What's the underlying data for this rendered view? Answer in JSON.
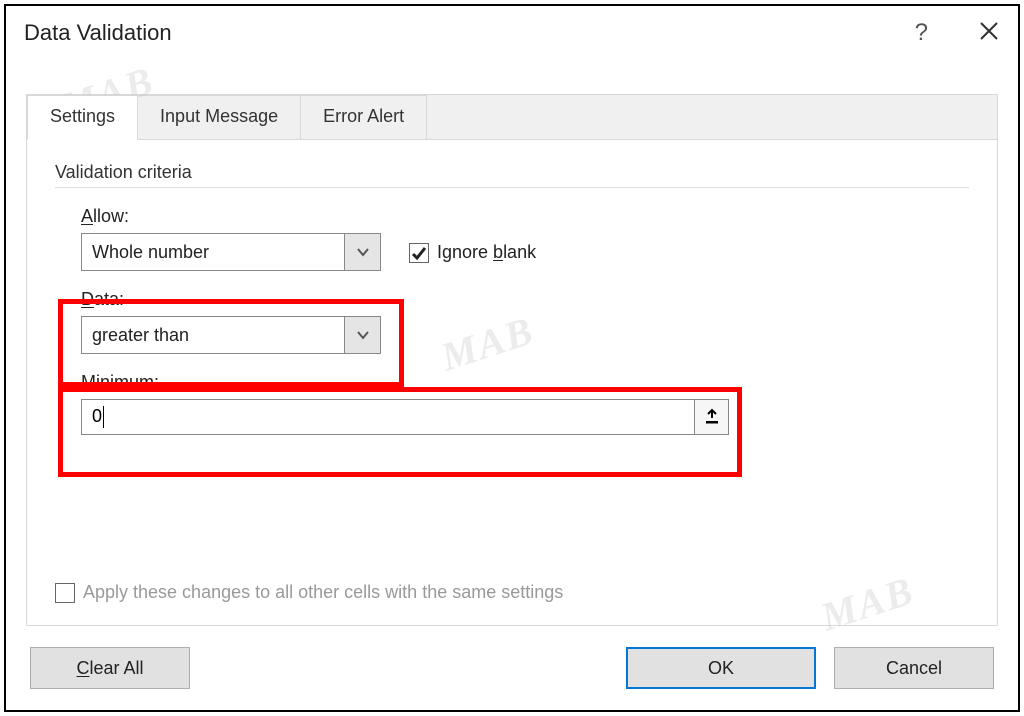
{
  "dialog": {
    "title": "Data Validation",
    "help": "?",
    "close": "✕"
  },
  "tabs": {
    "settings": "Settings",
    "input_message": "Input Message",
    "error_alert": "Error Alert"
  },
  "group_label": "Validation criteria",
  "allow": {
    "label_pre": "A",
    "label_rest": "llow:",
    "value": "Whole number"
  },
  "ignore_blank": {
    "pre": "Ignore ",
    "u": "b",
    "rest": "lank",
    "checked": true
  },
  "data": {
    "label_u": "D",
    "label_rest": "ata:",
    "value": "greater than"
  },
  "minimum": {
    "label_u": "M",
    "label_rest": "inimum:",
    "value": "0"
  },
  "apply_same": {
    "label": "Apply these changes to all other cells with the same settings",
    "checked": false
  },
  "buttons": {
    "clear_all_u": "C",
    "clear_all_rest": "lear All",
    "ok": "OK",
    "cancel": "Cancel"
  },
  "watermark": "MAB"
}
